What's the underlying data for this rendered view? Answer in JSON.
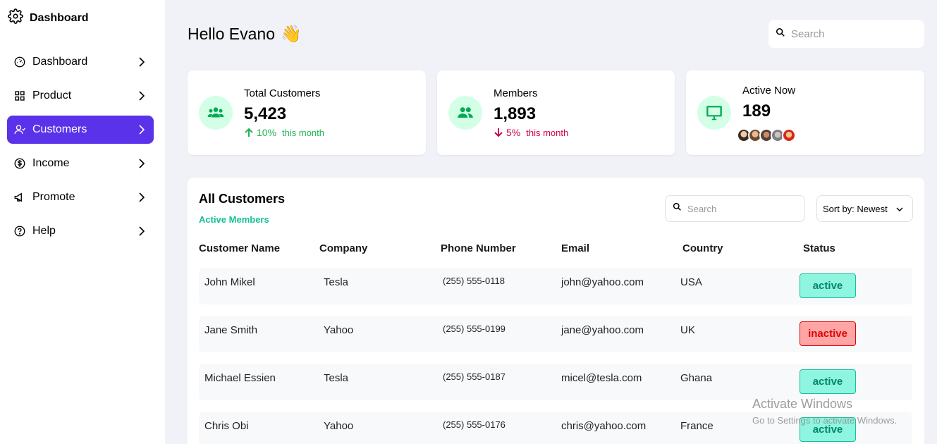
{
  "sidebar": {
    "brand": "Dashboard",
    "items": [
      {
        "label": "Dashboard",
        "icon": "speedometer-icon"
      },
      {
        "label": "Product",
        "icon": "grid-icon"
      },
      {
        "label": "Customers",
        "icon": "user-icon",
        "active": true
      },
      {
        "label": "Income",
        "icon": "dollar-circle-icon"
      },
      {
        "label": "Promote",
        "icon": "megaphone-icon"
      },
      {
        "label": "Help",
        "icon": "help-circle-icon"
      }
    ]
  },
  "header": {
    "greeting": "Hello Evano",
    "wave": "👋",
    "search_placeholder": "Search"
  },
  "stats": [
    {
      "label": "Total Customers",
      "value": "5,423",
      "trend": "10%",
      "direction": "up",
      "period": "this month"
    },
    {
      "label": "Members",
      "value": "1,893",
      "trend": "5%",
      "direction": "down",
      "period": "this month"
    },
    {
      "label": "Active Now",
      "value": "189"
    }
  ],
  "table": {
    "title": "All Customers",
    "subtitle": "Active Members",
    "search_placeholder": "Search",
    "sort_label": "Sort by: Newest",
    "columns": [
      "Customer Name",
      "Company",
      "Phone Number",
      "Email",
      "Country",
      "Status"
    ],
    "rows": [
      {
        "name": "John Mikel",
        "company": "Tesla",
        "phone": "(255) 555-0118",
        "email": "john@yahoo.com",
        "country": "USA",
        "status": "active"
      },
      {
        "name": "Jane Smith",
        "company": "Yahoo",
        "phone": "(255) 555-0199",
        "email": "jane@yahoo.com",
        "country": "UK",
        "status": "inactive"
      },
      {
        "name": "Michael Essien",
        "company": "Tesla",
        "phone": "(255) 555-0187",
        "email": "micel@tesla.com",
        "country": "Ghana",
        "status": "active"
      },
      {
        "name": "Chris Obi",
        "company": "Yahoo",
        "phone": "(255) 555-0176",
        "email": "chris@yahoo.com",
        "country": "France",
        "status": "active"
      }
    ]
  },
  "watermark": {
    "line1": "Activate Windows",
    "line2": "Go to Settings to activate Windows."
  },
  "colors": {
    "accent": "#5932ea",
    "positive": "#20b455",
    "negative": "#d0004b",
    "badge_active_bg": "#8ef5e0",
    "badge_inactive_bg": "#ffa5a5"
  }
}
